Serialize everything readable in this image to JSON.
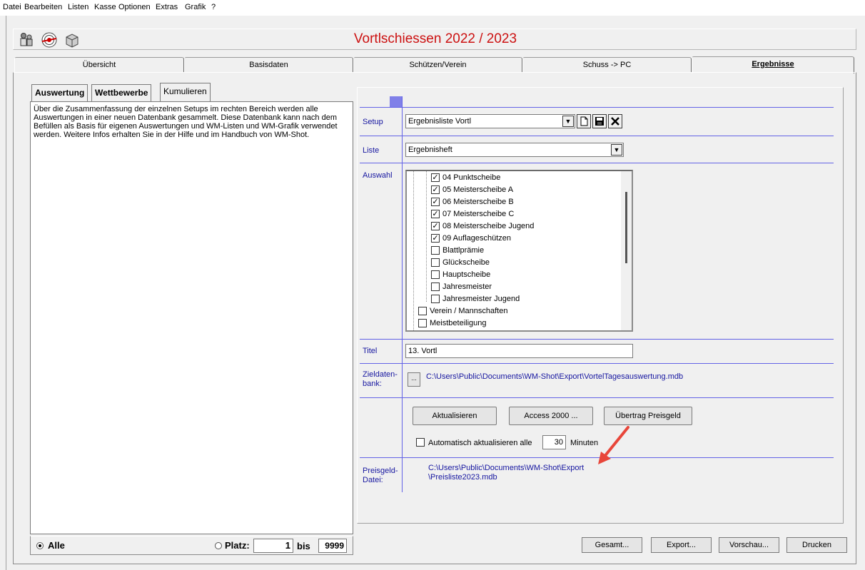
{
  "menu": [
    "Datei",
    "Bearbeiten",
    "Listen",
    "Kasse",
    "Optionen",
    "Extras",
    "Grafik",
    "?"
  ],
  "title": "Vortlschiessen 2022 / 2023",
  "toolbar_icons": [
    "people-icon",
    "target-icon",
    "box-icon"
  ],
  "tabs": [
    {
      "label": "Übersicht"
    },
    {
      "label": "Basisdaten"
    },
    {
      "label": "Schützen/Verein"
    },
    {
      "label": "Schuss -> PC"
    },
    {
      "label": "Ergebnisse"
    }
  ],
  "left": {
    "subtabs": [
      "Auswertung",
      "Wettbewerbe",
      "Kumulieren"
    ],
    "text": "Über die Zusammenfassung der einzelnen Setups im rechten Bereich werden alle Auswertungen in einer neuen Datenbank gesammelt. Diese Datenbank kann nach dem Befüllen als Basis für eigenen Auswertungen und WM-Listen und WM-Grafik verwendet werden. Weitere Infos erhalten Sie in der Hilfe und im Handbuch von WM-Shot.",
    "radio_all": "Alle",
    "radio_platz": "Platz:",
    "platz_from": "1",
    "bis_label": "bis",
    "platz_to": "9999"
  },
  "right": {
    "setup_label": "Setup",
    "setup_value": "Ergebnisliste Vortl",
    "liste_label": "Liste",
    "liste_value": "Ergebnisheft",
    "auswahl_label": "Auswahl",
    "auswahl_items": [
      {
        "label": "04 Punktscheibe",
        "checked": true,
        "level": 2
      },
      {
        "label": "05 Meisterscheibe A",
        "checked": true,
        "level": 2
      },
      {
        "label": "06 Meisterscheibe B",
        "checked": true,
        "level": 2
      },
      {
        "label": "07 Meisterscheibe C",
        "checked": true,
        "level": 2
      },
      {
        "label": "08 Meisterscheibe Jugend",
        "checked": true,
        "level": 2
      },
      {
        "label": "09 Auflageschützen",
        "checked": true,
        "level": 2
      },
      {
        "label": "Blattlprämie",
        "checked": false,
        "level": 2
      },
      {
        "label": "Glückscheibe",
        "checked": false,
        "level": 2
      },
      {
        "label": "Hauptscheibe",
        "checked": false,
        "level": 2
      },
      {
        "label": "Jahresmeister",
        "checked": false,
        "level": 2
      },
      {
        "label": "Jahresmeister Jugend",
        "checked": false,
        "level": 2
      },
      {
        "label": "Verein / Mannschaften",
        "checked": false,
        "level": 1
      },
      {
        "label": "Meistbeteiligung",
        "checked": false,
        "level": 1
      }
    ],
    "titel_label": "Titel",
    "titel_value": "13. Vortl",
    "zieldaten_label_1": "Zieldaten-",
    "zieldaten_label_2": "bank:",
    "browse_label": "...",
    "zieldaten_path": "C:\\Users\\Public\\Documents\\WM-Shot\\Export\\VortelTagesauswertung.mdb",
    "btn_aktualisieren": "Aktualisieren",
    "btn_access": "Access 2000 ...",
    "btn_uebertrag": "Übertrag Preisgeld",
    "auto_label": "Automatisch aktualisieren alle",
    "auto_minutes": "30",
    "minuten_label": "Minuten",
    "preisgeld_label_1": "Preisgeld-",
    "preisgeld_label_2": "Datei:",
    "preisgeld_path_1": "C:\\Users\\Public\\Documents\\WM-Shot\\Export",
    "preisgeld_path_2": "\\Preisliste2023.mdb"
  },
  "bottom_buttons": [
    "Gesamt...",
    "Export...",
    "Vorschau...",
    "Drucken"
  ],
  "colors": {
    "title": "#cc1111",
    "label": "#1616a0",
    "divider": "#6262e6",
    "arrow": "#e8463a"
  }
}
